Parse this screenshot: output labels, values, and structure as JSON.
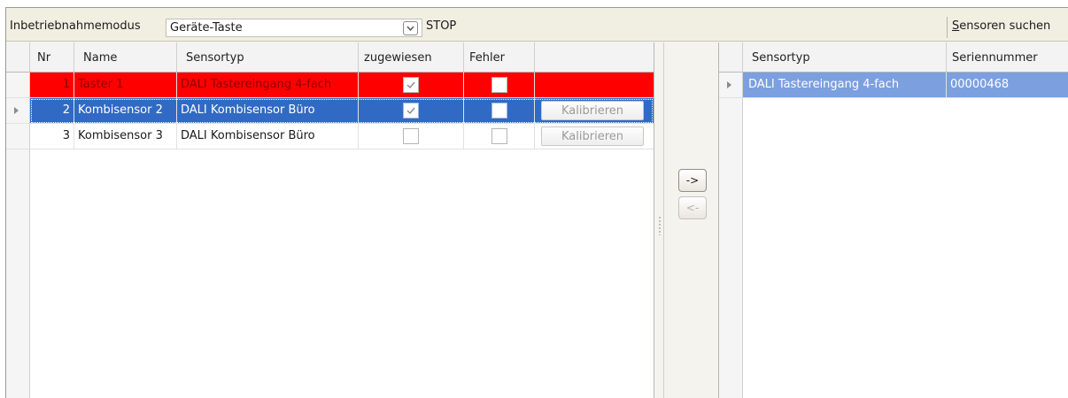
{
  "toolbar": {
    "mode_label": "Inbetriebnahmemodus",
    "mode_value": "Geräte-Taste",
    "stop_label": "STOP",
    "search_label": "Sensoren suchen"
  },
  "left_table": {
    "columns": [
      "Nr",
      "Name",
      "Sensortyp",
      "zugewiesen",
      "Fehler"
    ],
    "rows": [
      {
        "nr": "1",
        "name": "Taster 1",
        "sensortyp": "DALI Tastereingang 4-fach",
        "zugewiesen": true,
        "fehler": false,
        "kalibrieren": "",
        "state": "error"
      },
      {
        "nr": "2",
        "name": "Kombisensor 2",
        "sensortyp": "DALI Kombisensor Büro",
        "zugewiesen": true,
        "fehler": false,
        "kalibrieren": "Kalibrieren",
        "state": "selected"
      },
      {
        "nr": "3",
        "name": "Kombisensor 3",
        "sensortyp": "DALI Kombisensor Büro",
        "zugewiesen": false,
        "fehler": false,
        "kalibrieren": "Kalibrieren",
        "state": "normal"
      }
    ]
  },
  "move_buttons": {
    "assign_label": "->",
    "unassign_label": "<-"
  },
  "right_table": {
    "columns": [
      "Sensortyp",
      "Seriennummer"
    ],
    "rows": [
      {
        "sensortyp": "DALI Tastereingang 4-fach",
        "seriennummer": "00000468"
      }
    ]
  },
  "colors": {
    "error_row": "#ff0000",
    "selected_row": "#316ac5",
    "right_selected_row": "#7c9fe0"
  }
}
